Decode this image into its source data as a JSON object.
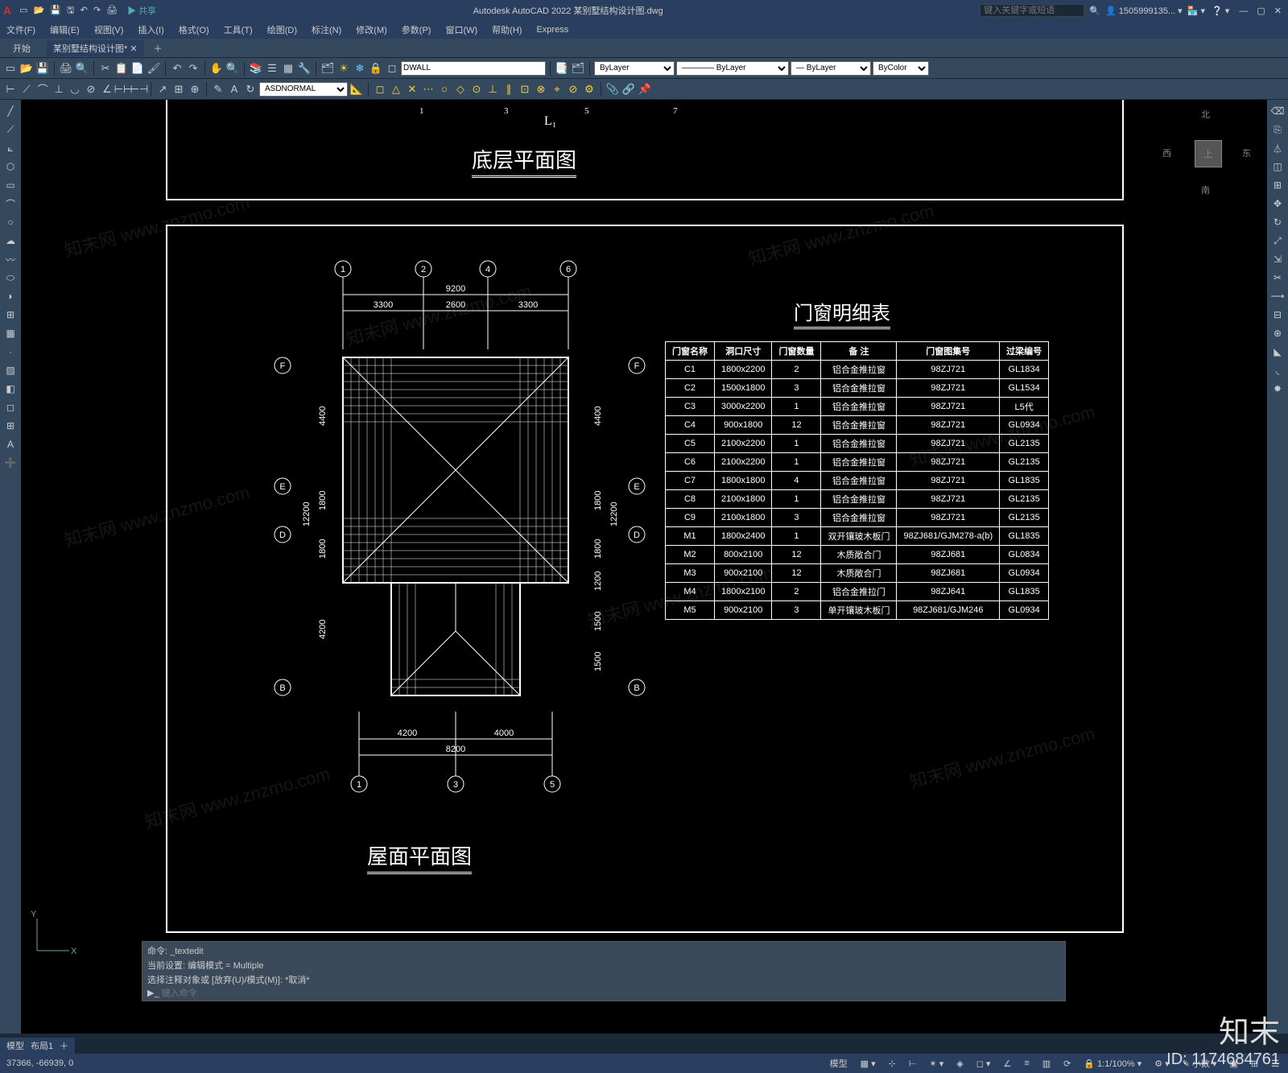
{
  "app": {
    "title": "Autodesk AutoCAD 2022   某别墅结构设计图.dwg",
    "logo": "A",
    "share": "共享",
    "search_ph": "键入关键字或短语",
    "user": "1505999135...",
    "help": "?"
  },
  "menu": [
    "文件(F)",
    "编辑(E)",
    "视图(V)",
    "插入(I)",
    "格式(O)",
    "工具(T)",
    "绘图(D)",
    "标注(N)",
    "修改(M)",
    "参数(P)",
    "窗口(W)",
    "帮助(H)",
    "Express"
  ],
  "tabs": {
    "start": "开始",
    "doc": "某别墅结构设计图*"
  },
  "toolbar": {
    "layer_input": "DWALL",
    "style": "ASDNORMAL",
    "bylayer": "ByLayer",
    "bycolor": "ByColor"
  },
  "viewcube": {
    "n": "北",
    "s": "南",
    "e": "东",
    "w": "西",
    "top": "上"
  },
  "drawing": {
    "title1": "底层平面图",
    "title2": "屋面平面图",
    "table_title": "门窗明细表",
    "headers": [
      "门窗名称",
      "洞口尺寸",
      "门窗数量",
      "备  注",
      "门窗图集号",
      "过梁编号"
    ],
    "rows": [
      [
        "C1",
        "1800x2200",
        "2",
        "铝合金推拉窗",
        "98ZJ721",
        "GL1834"
      ],
      [
        "C2",
        "1500x1800",
        "3",
        "铝合金推拉窗",
        "98ZJ721",
        "GL1534"
      ],
      [
        "C3",
        "3000x2200",
        "1",
        "铝合金推拉窗",
        "98ZJ721",
        "L5代"
      ],
      [
        "C4",
        "900x1800",
        "12",
        "铝合金推拉窗",
        "98ZJ721",
        "GL0934"
      ],
      [
        "C5",
        "2100x2200",
        "1",
        "铝合金推拉窗",
        "98ZJ721",
        "GL2135"
      ],
      [
        "C6",
        "2100x2200",
        "1",
        "铝合金推拉窗",
        "98ZJ721",
        "GL2135"
      ],
      [
        "C7",
        "1800x1800",
        "4",
        "铝合金推拉窗",
        "98ZJ721",
        "GL1835"
      ],
      [
        "C8",
        "2100x1800",
        "1",
        "铝合金推拉窗",
        "98ZJ721",
        "GL2135"
      ],
      [
        "C9",
        "2100x1800",
        "3",
        "铝合金推拉窗",
        "98ZJ721",
        "GL2135"
      ],
      [
        "M1",
        "1800x2400",
        "1",
        "双开镶玻木板门",
        "98ZJ681/GJM278-a(b)",
        "GL1835"
      ],
      [
        "M2",
        "800x2100",
        "12",
        "木质敞合门",
        "98ZJ681",
        "GL0834"
      ],
      [
        "M3",
        "900x2100",
        "12",
        "木质敞合门",
        "98ZJ681",
        "GL0934"
      ],
      [
        "M4",
        "1800x2100",
        "2",
        "铝合金推拉门",
        "98ZJ641",
        "GL1835"
      ],
      [
        "M5",
        "900x2100",
        "3",
        "单开镶玻木板门",
        "98ZJ681/GJM246",
        "GL0934"
      ]
    ],
    "dims_top": {
      "total": "9200",
      "a": "3300",
      "b": "2600",
      "c": "3300"
    },
    "dims_bot": {
      "total": "8200",
      "a": "4200",
      "b": "4000"
    },
    "dims_left": {
      "total": "12200",
      "a": "4400",
      "b": "1800",
      "c": "1800",
      "d": "4200"
    },
    "dims_right": {
      "total": "12200",
      "a": "4400",
      "b": "1800",
      "c": "1800",
      "d": "1200",
      "e": "1500",
      "f": "1500"
    },
    "grids_top": [
      "1",
      "2",
      "4",
      "6"
    ],
    "grids_bot": [
      "1",
      "3",
      "5"
    ],
    "grids_upper": [
      "1",
      "3",
      "5",
      "7"
    ],
    "grids_lr": [
      "F",
      "E",
      "D",
      "B"
    ],
    "L1": "L₁"
  },
  "cmd": {
    "l1": "命令: _textedit",
    "l2": "当前设置: 编辑模式 = Multiple",
    "l3": "选择注释对象或 [放弃(U)/模式(M)]: *取消*",
    "prompt": "键入命令"
  },
  "status": {
    "model": "模型",
    "layout": "布局1",
    "coords": "37366, -66939, 0",
    "scale": "1:1/100%",
    "dec": "小数"
  },
  "watermark": {
    "site": "知末网 www.znzmo.com",
    "brand": "知末",
    "id": "ID: 1174684761"
  }
}
